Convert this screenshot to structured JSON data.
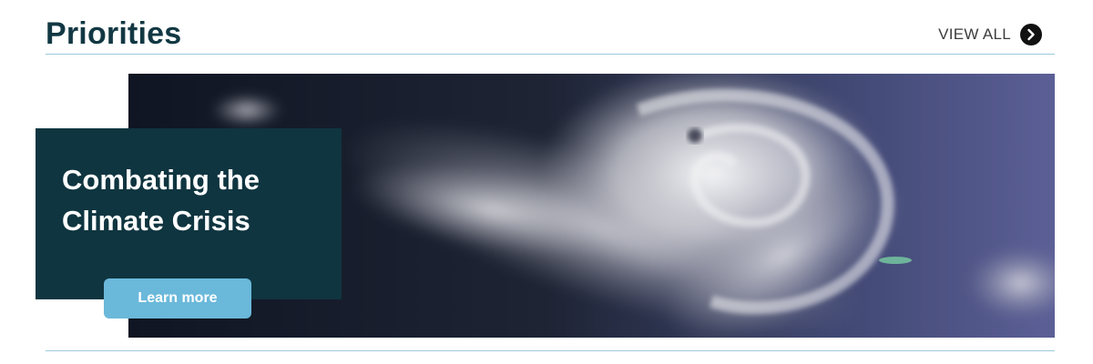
{
  "section": {
    "title": "Priorities",
    "view_all_label": "VIEW ALL",
    "view_all_icon": "chevron-right-icon"
  },
  "feature": {
    "title_line1": "Combating the",
    "title_line2": "Climate Crisis",
    "button_label": "Learn more",
    "image_subject": "satellite-hurricane-photo"
  },
  "colors": {
    "heading": "#123843",
    "card_background": "#0f3540",
    "button_background": "#6ab8da",
    "divider": "#9cc9dc",
    "icon_circle": "#111111"
  }
}
